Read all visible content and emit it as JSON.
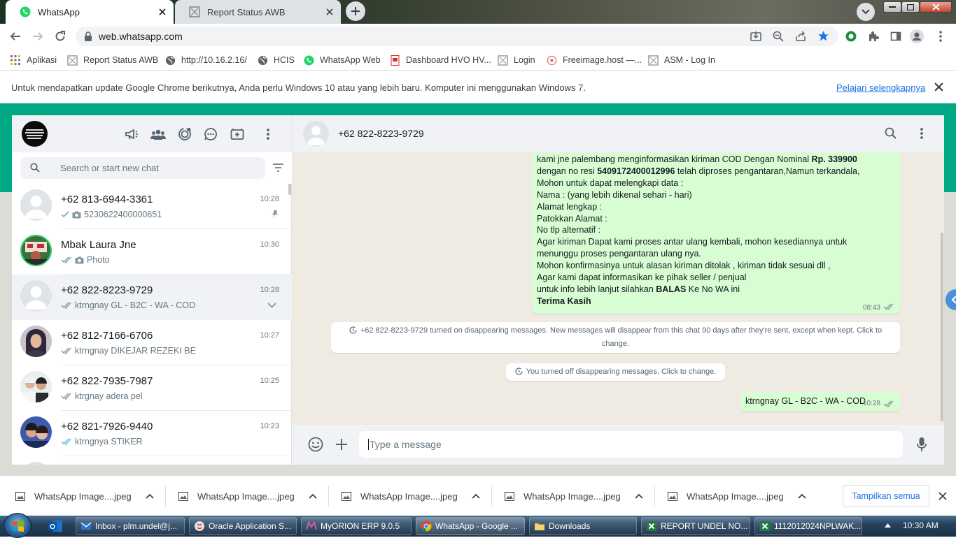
{
  "browser": {
    "tabs": [
      {
        "title": "WhatsApp",
        "active": true
      },
      {
        "title": "Report Status AWB",
        "active": false
      }
    ],
    "url": "web.whatsapp.com",
    "bookmarks": [
      "Aplikasi",
      "Report Status AWB",
      "http://10.16.2.16/",
      "HCIS",
      "WhatsApp Web",
      "Dashboard HVO HV...",
      "Login",
      "Freeimage.host —...",
      "ASM - Log In"
    ],
    "infobar": {
      "message": "Untuk mendapatkan update Google Chrome berikutnya, Anda perlu Windows 10 atau yang lebih baru. Komputer ini menggunakan Windows 7.",
      "link": "Pelajari selengkapnya"
    }
  },
  "sidebar": {
    "search_placeholder": "Search or start new chat",
    "chats": [
      {
        "name": "+62 813-6944-3361",
        "time": "10:28",
        "preview": "5230622400000651",
        "has_camera": true,
        "pinned": true
      },
      {
        "name": "Mbak Laura Jne",
        "time": "10:30",
        "preview": "Photo",
        "has_camera": true
      },
      {
        "name": "+62 822-8223-9729",
        "time": "10:28",
        "preview": "ktrngnay GL - B2C - WA - COD",
        "selected": true
      },
      {
        "name": "+62 812-7166-6706",
        "time": "10:27",
        "preview": "ktrngnay DIKEJAR REZEKI BE"
      },
      {
        "name": "+62 822-7935-7987",
        "time": "10:25",
        "preview": "ktrgnay adera pel"
      },
      {
        "name": "+62 821-7926-9440",
        "time": "10:23",
        "preview": "ktrngnya STIKER"
      }
    ]
  },
  "conversation": {
    "contact": "+62 822-8223-9729",
    "message": {
      "l1a": "kami jne palembang menginformasikan kiriman  COD Dengan Nominal ",
      "l1b": "Rp. 339900",
      "l2a": "dengan no resi ",
      "l2b": "5409172400012996",
      "l2c": " telah diproses pengantaran,Namun terkandala,",
      "l3": "Mohon untuk dapat melengkapi data :",
      "l4": "Nama : (yang lebih dikenal sehari - hari)",
      "l5": "Alamat  lengkap :",
      "l6": "Patokkan Alamat :",
      "l7": "No tlp alternatif :",
      "l8": "Agar kiriman Dapat kami proses antar ulang kembali, mohon kesediannya untuk",
      "l9": "menunggu proses pengantaran ulang nya.",
      "l10": "Mohon konfirmasinya untuk alasan kiriman ditolak , kiriman tidak sesuai dll ,",
      "l11": "Agar kami dapat informasikan ke pihak seller / penjual",
      "l12a": "untuk info lebih lanjut silahkan ",
      "l12b": "BALAS",
      "l12c": " Ke No WA ini",
      "l13": "Terima Kasih",
      "time": "08:43"
    },
    "system1_line1": "+62 822-8223-9729 turned on disappearing messages. New messages will disappear from this chat 90 days after they're sent, except when kept. Click to",
    "system1_line2": "change.",
    "system2": "You turned off disappearing messages. Click to change.",
    "last_message": {
      "text": "ktrngnay GL - B2C - WA - COD",
      "time": "10:28"
    },
    "composer_placeholder": "Type a message"
  },
  "downloads": {
    "items": [
      "WhatsApp Image....jpeg",
      "WhatsApp Image....jpeg",
      "WhatsApp Image....jpeg",
      "WhatsApp Image....jpeg",
      "WhatsApp Image....jpeg"
    ],
    "show_all": "Tampilkan semua"
  },
  "taskbar": {
    "items": [
      "Inbox - plm.undel@j...",
      "Oracle Application S...",
      "MyORION ERP 9.0.5",
      "WhatsApp - Google ...",
      "Downloads",
      "REPORT UNDEL NO...",
      "1112012024NPLWAK..."
    ],
    "clock": "10:30 AM"
  },
  "colors": {
    "wa_green": "#00a884",
    "bubble_out": "#d9fdd3",
    "tick_read": "#53bdeb",
    "chrome_blue": "#1a73e8"
  }
}
